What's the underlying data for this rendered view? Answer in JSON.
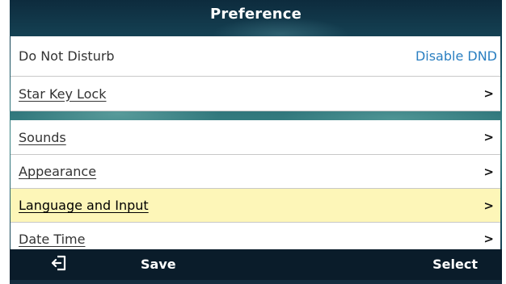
{
  "header": {
    "title": "Preference"
  },
  "menu": {
    "items": [
      {
        "label": "Do Not Disturb",
        "value": "Disable DND",
        "has_chevron": false
      },
      {
        "label": "Star Key Lock",
        "value": "",
        "has_chevron": true
      },
      {
        "label": "Sounds",
        "value": "",
        "has_chevron": true
      },
      {
        "label": "Appearance",
        "value": "",
        "has_chevron": true
      },
      {
        "label": "Language and Input",
        "value": "",
        "has_chevron": true,
        "selected": true
      },
      {
        "label": "Date Time",
        "value": "",
        "has_chevron": true
      }
    ],
    "chevron_glyph": ">"
  },
  "softkeys": {
    "back_icon": "exit-back-icon",
    "save_label": "Save",
    "select_label": "Select"
  },
  "colors": {
    "highlight": "#fdf6b8",
    "value_text": "#2a7fc1",
    "softkey_bar": "#0a1c2a",
    "active_underline": "#3f7ec2"
  }
}
